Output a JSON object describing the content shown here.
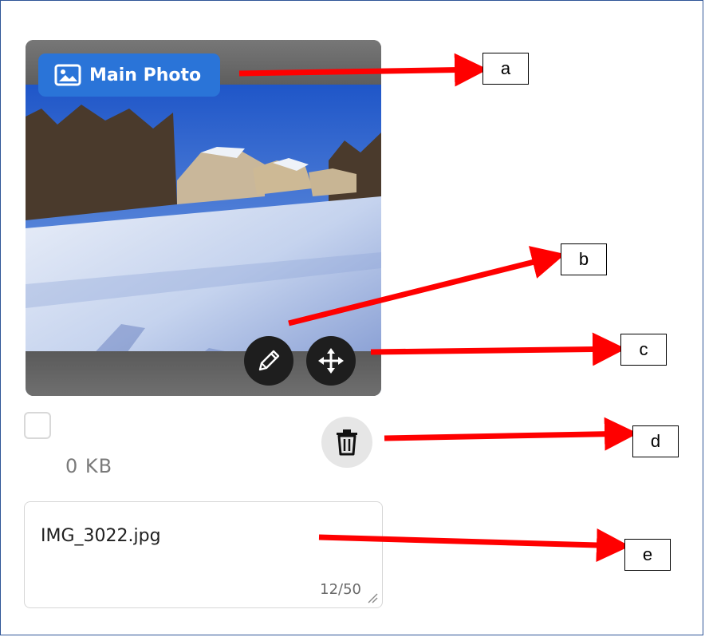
{
  "photo": {
    "badge_label": "Main Photo"
  },
  "file": {
    "size": "0 KB",
    "name": "IMG_3022.jpg",
    "char_count": "12/50"
  },
  "callouts": {
    "a": "a",
    "b": "b",
    "c": "c",
    "d": "d",
    "e": "e"
  },
  "icons": {
    "badge": "image-icon",
    "edit": "pencil-icon",
    "move": "move-icon",
    "delete": "trash-icon"
  },
  "colors": {
    "badge_bg": "#2a74d8",
    "arrow": "#ff0000",
    "round_button_bg": "#1e1e1e",
    "trash_button_bg": "#e6e6e6"
  }
}
